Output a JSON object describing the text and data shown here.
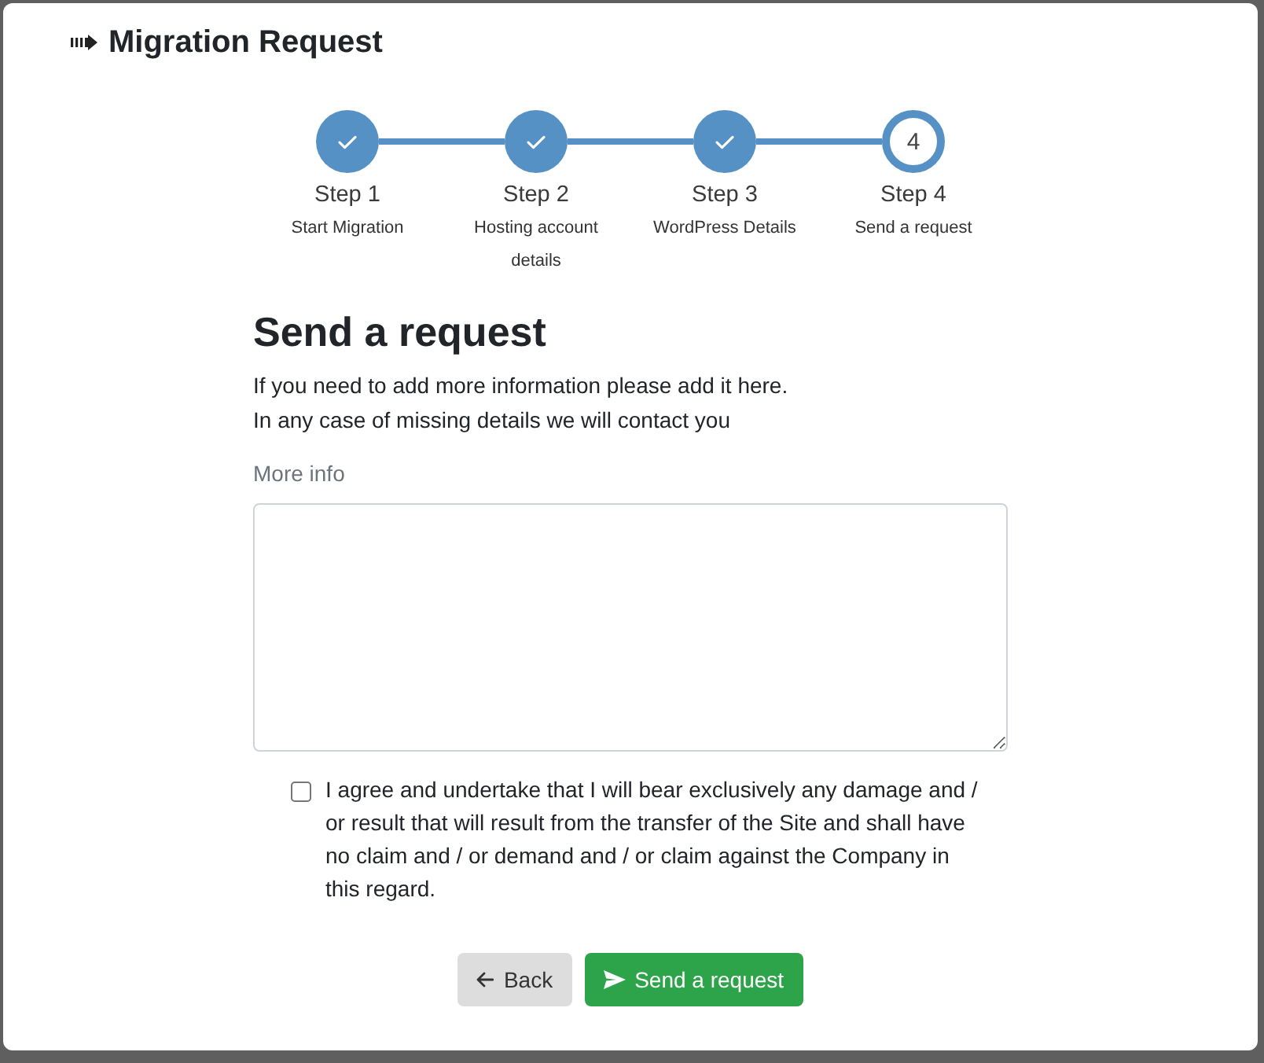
{
  "dialog": {
    "title": "Migration Request"
  },
  "steps": [
    {
      "label": "Step 1",
      "caption": "Start Migration",
      "completed": true
    },
    {
      "label": "Step 2",
      "caption": "Hosting account details",
      "completed": true
    },
    {
      "label": "Step 3",
      "caption": "WordPress Details",
      "completed": true
    },
    {
      "label": "Step 4",
      "caption": "Send a request",
      "completed": false,
      "number": "4"
    }
  ],
  "form": {
    "heading": "Send a request",
    "intro": [
      "If you need to add more information please add it here.",
      "In any case of missing details we will contact you"
    ],
    "field_label": "More info",
    "agreement": {
      "checked": false,
      "text": "I agree and undertake that I will bear exclusively any damage and / or result that will result from the transfer of the Site and shall have no claim and / or demand and / or claim against the Company in this regard."
    }
  },
  "buttons": [
    {
      "kind": "back",
      "label": "Back"
    },
    {
      "kind": "submit",
      "label": "Send a request"
    }
  ]
}
